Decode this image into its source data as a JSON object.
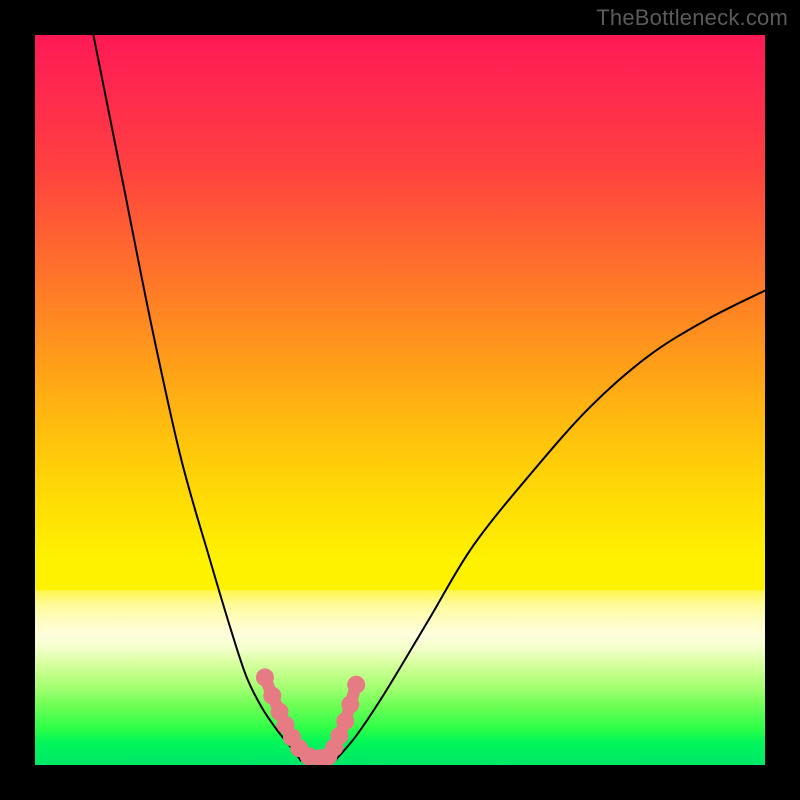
{
  "watermark": "TheBottleneck.com",
  "chart_data": {
    "type": "line",
    "title": "",
    "xlabel": "",
    "ylabel": "",
    "xlim": [
      0,
      100
    ],
    "ylim": [
      0,
      100
    ],
    "grid": false,
    "legend": false,
    "series": [
      {
        "name": "left-curve",
        "color": "#000000",
        "x": [
          8,
          12,
          16,
          20,
          24,
          27,
          29,
          31,
          33,
          35,
          36.5
        ],
        "y": [
          100,
          80,
          60,
          42,
          28,
          18,
          12,
          8,
          5,
          2.5,
          0.5
        ]
      },
      {
        "name": "right-curve",
        "color": "#000000",
        "x": [
          41,
          44,
          48,
          54,
          60,
          68,
          76,
          84,
          92,
          100
        ],
        "y": [
          0.5,
          4,
          10,
          20,
          30,
          40,
          49,
          56,
          61,
          65
        ]
      },
      {
        "name": "bottom-path",
        "color": "#e77b84",
        "x": [
          31.5,
          32.5,
          33.5,
          34.3,
          35.2,
          36.2,
          37.5,
          39,
          40.2,
          41,
          41.7,
          42.5,
          43.2,
          44
        ],
        "y": [
          12,
          9.5,
          7.3,
          5.5,
          3.8,
          2.3,
          1.2,
          0.9,
          1.2,
          2.4,
          4,
          6,
          8.3,
          11
        ]
      }
    ],
    "scatter_points": {
      "name": "bottom-dots",
      "color": "#e77b84",
      "x": [
        31.5,
        32.5,
        33.5,
        34.3,
        35.2,
        36.2,
        37.5,
        39,
        40.2,
        41,
        41.7,
        42.5,
        43.2,
        44
      ],
      "y": [
        12,
        9.5,
        7.3,
        5.5,
        3.8,
        2.3,
        1.2,
        0.9,
        1.2,
        2.4,
        4,
        6,
        8.3,
        11
      ]
    }
  }
}
